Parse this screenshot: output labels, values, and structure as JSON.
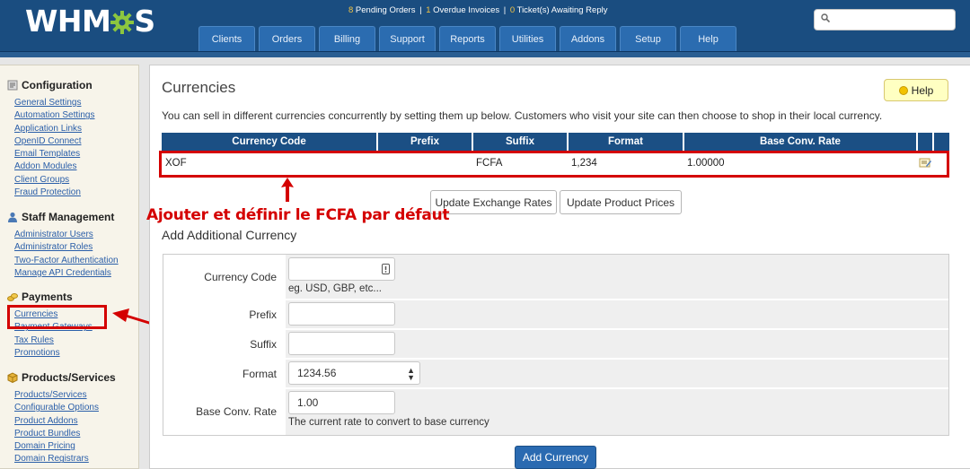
{
  "header": {
    "logo_text_start": "WHM",
    "logo_text_end": "S",
    "notifications": {
      "pending_orders_count": "8",
      "pending_orders_label": " Pending Orders",
      "overdue_count": "1",
      "overdue_label": " Overdue Invoices",
      "tickets_count": "0",
      "tickets_label": " Ticket(s) Awaiting Reply"
    },
    "nav": [
      "Clients",
      "Orders",
      "Billing",
      "Support",
      "Reports",
      "Utilities",
      "Addons",
      "Setup",
      "Help"
    ],
    "search_placeholder": ""
  },
  "sidebar": {
    "configuration": {
      "title": "Configuration",
      "links": [
        "General Settings",
        "Automation Settings",
        "Application Links",
        "OpenID Connect",
        "Email Templates",
        "Addon Modules",
        "Client Groups",
        "Fraud Protection"
      ]
    },
    "staff": {
      "title": "Staff Management",
      "links": [
        "Administrator Users",
        "Administrator Roles",
        "Two-Factor Authentication",
        "Manage API Credentials"
      ]
    },
    "payments": {
      "title": "Payments",
      "links": [
        "Currencies",
        "Payment Gateways",
        "Tax Rules",
        "Promotions"
      ]
    },
    "products": {
      "title": "Products/Services",
      "links": [
        "Products/Services",
        "Configurable Options",
        "Product Addons",
        "Product Bundles",
        "Domain Pricing",
        "Domain Registrars"
      ]
    }
  },
  "main": {
    "title": "Currencies",
    "help_label": "Help",
    "intro": "You can sell in different currencies concurrently by setting them up below. Customers who visit your site can then choose to shop in their local currency.",
    "table": {
      "headers": [
        "Currency Code",
        "Prefix",
        "Suffix",
        "Format",
        "Base Conv. Rate"
      ],
      "rows": [
        {
          "code": "XOF",
          "prefix": "",
          "suffix": "FCFA",
          "format": "1,234",
          "rate": "1.00000"
        }
      ]
    },
    "update_rates_label": "Update Exchange Rates",
    "update_prices_label": "Update Product Prices",
    "annotation": "Ajouter et définir le FCFA par défaut",
    "add_title": "Add Additional Currency",
    "form": {
      "currency_code_label": "Currency Code",
      "currency_code_value": "",
      "currency_code_hint": "eg. USD, GBP, etc...",
      "prefix_label": "Prefix",
      "prefix_value": "",
      "suffix_label": "Suffix",
      "suffix_value": "",
      "format_label": "Format",
      "format_value": "1234.56",
      "rate_label": "Base Conv. Rate",
      "rate_value": "1.00",
      "rate_hint": "The current rate to convert to base currency"
    },
    "add_button_label": "Add Currency"
  },
  "colors": {
    "header_bg": "#1a4d80",
    "nav_tab": "#2b6cb0",
    "table_header": "#1b4f84",
    "annotation_red": "#d40000",
    "primary_button": "#2a6ab1",
    "sidebar_bg": "#f7f4ea"
  }
}
